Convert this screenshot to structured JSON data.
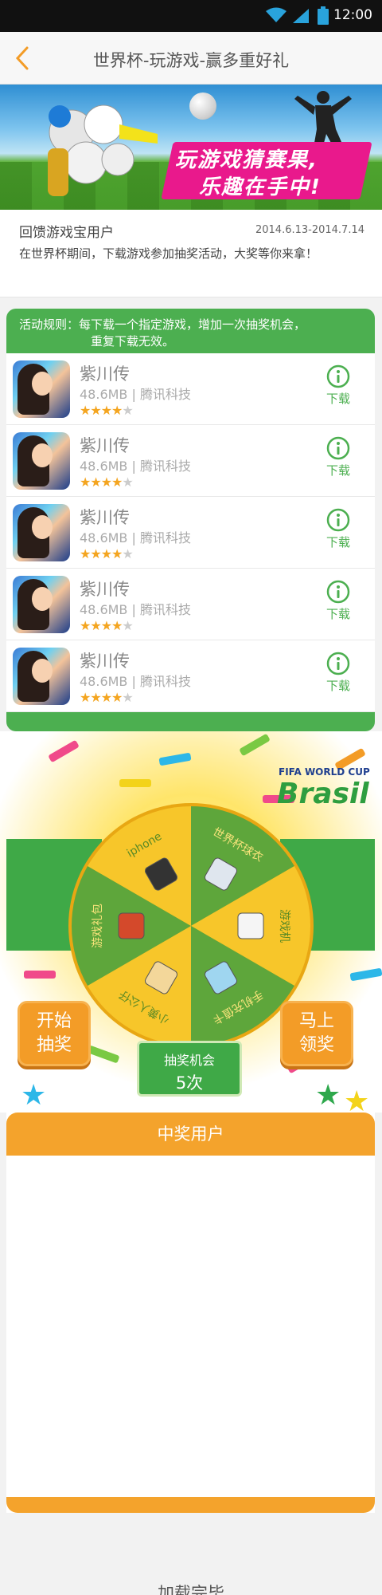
{
  "status_bar": {
    "time": "12:00",
    "icons": [
      "wifi-icon",
      "signal-icon",
      "battery-icon"
    ]
  },
  "header": {
    "title": "世界杯-玩游戏-赢多重好礼",
    "back_icon": "chevron-left-icon"
  },
  "banner": {
    "slogan_line1": "玩游戏猜赛果,",
    "slogan_line2": "乐趣在手中!"
  },
  "info": {
    "who": "回馈游戏宝用户",
    "date_range": "2014.6.13-2014.7.14",
    "description": "在世界杯期间，下载游戏参加抽奖活动，大奖等你来拿！"
  },
  "rules": {
    "text_line1": "活动规则：每下载一个指定游戏，增加一次抽奖机会，",
    "text_line2": "重复下载无效。"
  },
  "games": [
    {
      "name": "紫川传",
      "size": "48.6MB",
      "publisher": "腾讯科技",
      "rating": 4,
      "download_label": "下载"
    },
    {
      "name": "紫川传",
      "size": "48.6MB",
      "publisher": "腾讯科技",
      "rating": 4,
      "download_label": "下载"
    },
    {
      "name": "紫川传",
      "size": "48.6MB",
      "publisher": "腾讯科技",
      "rating": 4,
      "download_label": "下载"
    },
    {
      "name": "紫川传",
      "size": "48.6MB",
      "publisher": "腾讯科技",
      "rating": 4,
      "download_label": "下载"
    },
    {
      "name": "紫川传",
      "size": "48.6MB",
      "publisher": "腾讯科技",
      "rating": 4,
      "download_label": "下载"
    }
  ],
  "lottery": {
    "fifa_top": "FIFA WORLD CUP",
    "fifa_brasil": "Brasil",
    "prizes": [
      "世界杯球衣",
      "游戏机",
      "手机充值卡",
      "小黄人公仔",
      "游戏礼包",
      "iphone"
    ],
    "start_button": [
      "开始",
      "抽奖"
    ],
    "claim_button": [
      "马上",
      "领奖"
    ],
    "chance_label": "抽奖机会",
    "chance_count": "5次"
  },
  "winners": {
    "title": "中奖用户"
  },
  "footer": {
    "loaded": "加载完毕"
  },
  "colors": {
    "green": "#4caf50",
    "orange": "#f4a32c",
    "wheel_green": "#5ea63b",
    "wheel_yellow": "#f7c62a"
  }
}
